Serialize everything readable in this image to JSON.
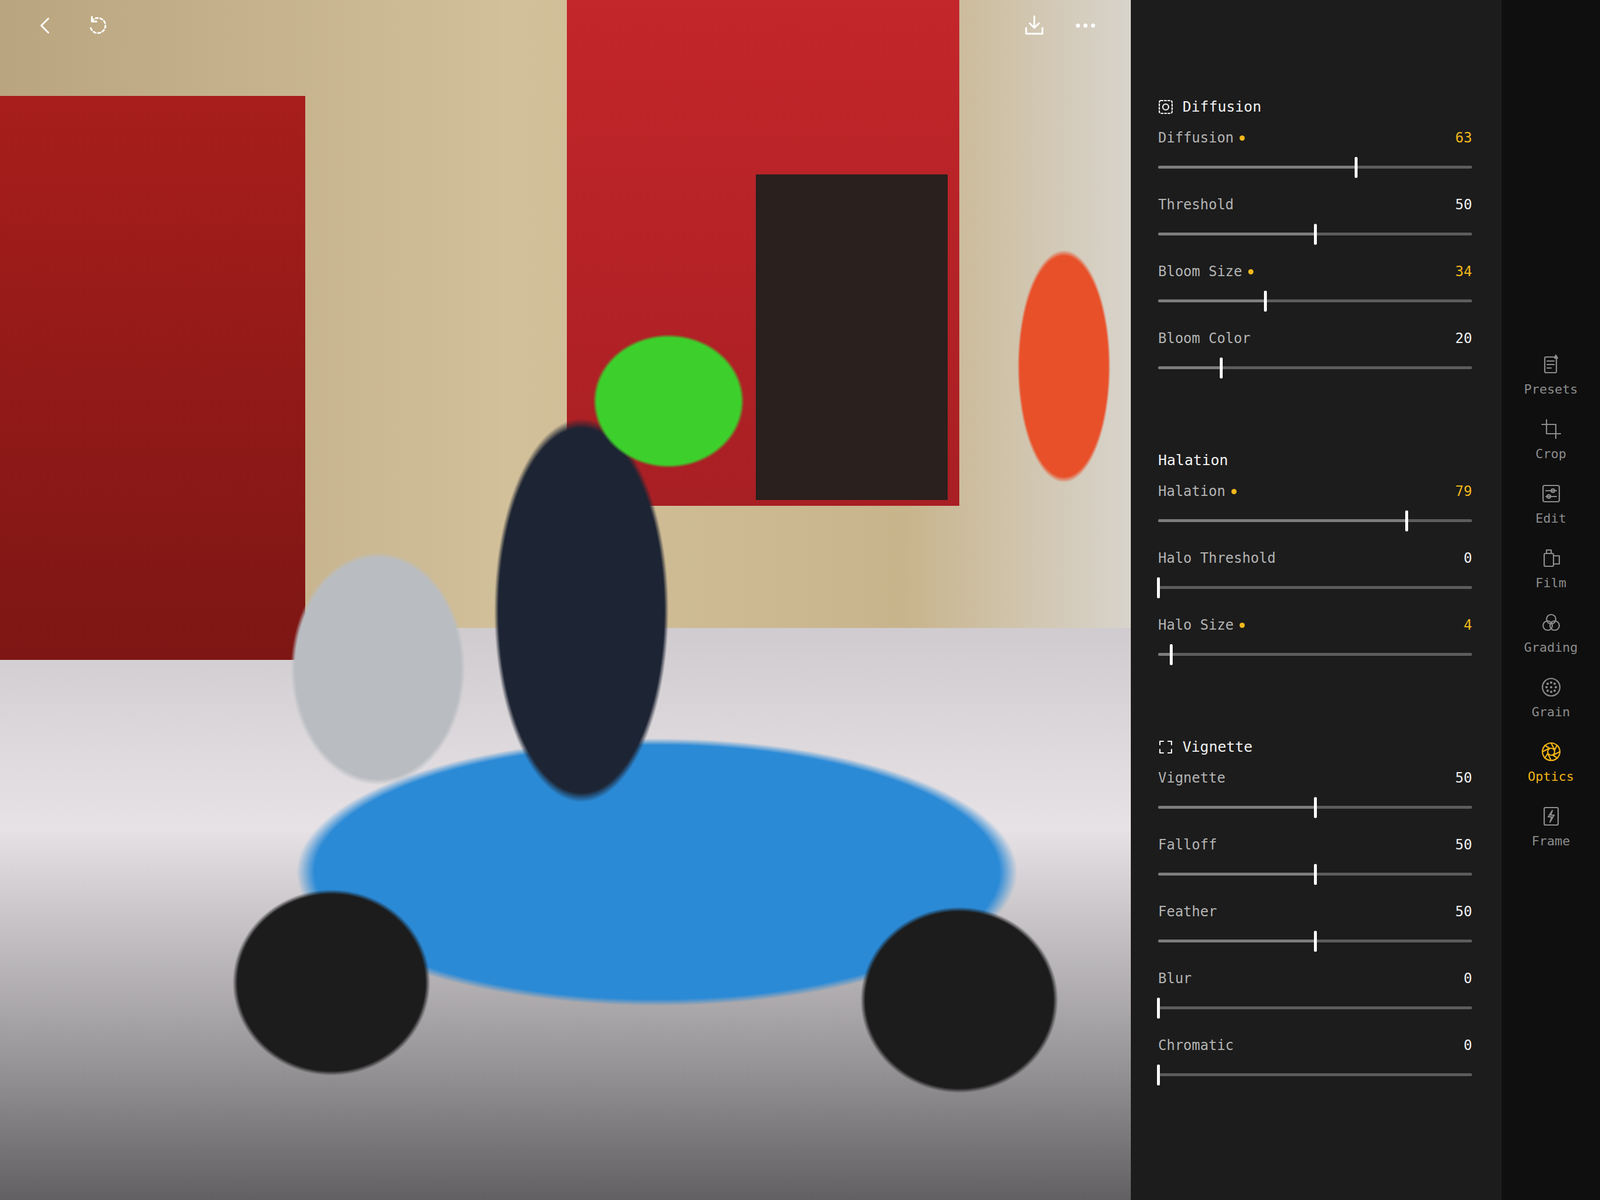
{
  "sections": [
    {
      "title": "Diffusion",
      "kind": "diffusion",
      "sliders": [
        {
          "label": "Diffusion",
          "value": "63",
          "modified": true,
          "level": 0.63
        },
        {
          "label": "Threshold",
          "value": "50",
          "modified": false,
          "level": 0.5
        },
        {
          "label": "Bloom Size",
          "value": "34",
          "modified": true,
          "level": 0.34
        },
        {
          "label": "Bloom Color",
          "value": "20",
          "modified": false,
          "level": 0.2
        }
      ]
    },
    {
      "title": "Halation",
      "kind": "plain",
      "sliders": [
        {
          "label": "Halation",
          "value": "79",
          "modified": true,
          "level": 0.79
        },
        {
          "label": "Halo Threshold",
          "value": "0",
          "modified": false,
          "level": 0
        },
        {
          "label": "Halo Size",
          "value": "4",
          "modified": true,
          "level": 0.04
        }
      ]
    },
    {
      "title": "Vignette",
      "kind": "vignette",
      "sliders": [
        {
          "label": "Vignette",
          "value": "50",
          "modified": false,
          "level": 0.5
        },
        {
          "label": "Falloff",
          "value": "50",
          "modified": false,
          "level": 0.5
        },
        {
          "label": "Feather",
          "value": "50",
          "modified": false,
          "level": 0.5
        },
        {
          "label": "Blur",
          "value": "0",
          "modified": false,
          "level": 0
        },
        {
          "label": "Chromatic",
          "value": "0",
          "modified": false,
          "level": 0
        }
      ]
    }
  ],
  "nav": [
    {
      "label": "Presets",
      "selected": false
    },
    {
      "label": "Crop",
      "selected": false
    },
    {
      "label": "Edit",
      "selected": false
    },
    {
      "label": "Film",
      "selected": false
    },
    {
      "label": "Grading",
      "selected": false
    },
    {
      "label": "Grain",
      "selected": false
    },
    {
      "label": "Optics",
      "selected": true
    },
    {
      "label": "Frame",
      "selected": false
    }
  ]
}
